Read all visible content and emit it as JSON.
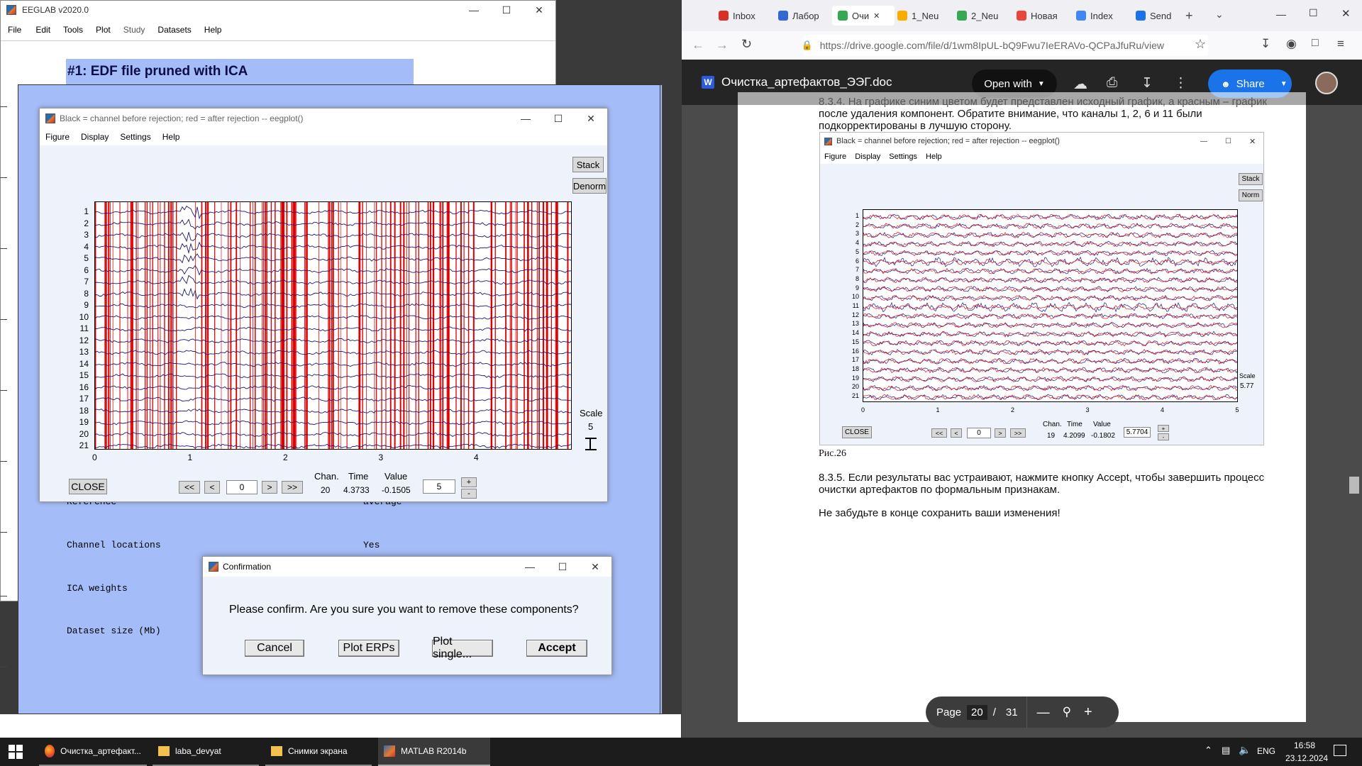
{
  "eeglab": {
    "title": "EEGLAB v2020.0",
    "menu": [
      "File",
      "Edit",
      "Tools",
      "Plot",
      "Study",
      "Datasets",
      "Help"
    ],
    "dataset_title": "#1: EDF file pruned with ICA",
    "rows": [
      {
        "label": "Reference",
        "value": "average"
      },
      {
        "label": "Channel locations",
        "value": "Yes"
      },
      {
        "label": "ICA weights",
        "value": ""
      },
      {
        "label": "Dataset size (Mb)",
        "value": ""
      }
    ]
  },
  "eegplot": {
    "title": "Black = channel before rejection; red = after rejection -- eegplot()",
    "menu": [
      "Figure",
      "Display",
      "Settings",
      "Help"
    ],
    "stack_label": "Stack",
    "norm_label": "Denorm",
    "channels": [
      "1",
      "2",
      "3",
      "4",
      "5",
      "6",
      "7",
      "8",
      "9",
      "10",
      "11",
      "12",
      "13",
      "14",
      "15",
      "16",
      "17",
      "18",
      "19",
      "20",
      "21"
    ],
    "x_ticks": [
      "0",
      "1",
      "2",
      "3",
      "4"
    ],
    "scale_label": "Scale",
    "scale_value": "5",
    "close_label": "CLOSE",
    "nav": [
      "<<",
      "<",
      "0",
      ">",
      ">>"
    ],
    "readout_headers": [
      "Chan.",
      "Time",
      "Value"
    ],
    "readout_values": [
      "20",
      "4.3733",
      "-0.1505"
    ],
    "scale_input": "5",
    "plus": "+",
    "minus": "-"
  },
  "confirm": {
    "title": "Confirmation",
    "message": "Please confirm. Are you sure you want to remove these components?",
    "buttons": [
      "Cancel",
      "Plot ERPs",
      "Plot single...",
      "Accept"
    ]
  },
  "browser": {
    "tabs": [
      "Inbox",
      "Лабор",
      "Очи",
      "1_Neu",
      "2_Neu",
      "Новая",
      "Index",
      "Send"
    ],
    "url": "https://drive.google.com/file/d/1wm8IpUL-bQ9Fwu7IeERAVo-QCPaJfuRu/view",
    "doc_title": "Очистка_артефактов_ЭЭГ.doc",
    "open_with": "Open with",
    "share": "Share",
    "pdf_text_1": "8.3.4. На графике синим цветом будет представлен исходный график, а красным – график",
    "pdf_text_2": "после удаления компонент. Обратите внимание, что каналы 1, 2, 6 и 11 были",
    "pdf_text_3": "подкорректированы в лучшую сторону.",
    "figure_caption": "Рис.26",
    "pdf_text_4": "8.3.5. Если результаты вас устраивают, нажмите кнопку Accept, чтобы завершить процесс",
    "pdf_text_5": "очистки артефактов по формальным признакам.",
    "pdf_text_6": "Не забудьте в конце сохранить ваши изменения!",
    "page_label": "Page",
    "page_current": "20",
    "page_sep": "/",
    "page_total": "31",
    "inner_plot": {
      "title": "Black = channel before rejection; red = after rejection -- eegplot()",
      "menu": [
        "Figure",
        "Display",
        "Settings",
        "Help"
      ],
      "stack": "Stack",
      "norm": "Norm",
      "scale_label": "Scale",
      "scale_value": "5.77",
      "close": "CLOSE",
      "x_ticks": [
        "0",
        "1",
        "2",
        "3",
        "4",
        "5"
      ],
      "readout_headers": [
        "Chan.",
        "Time",
        "Value"
      ],
      "readout_values": [
        "19",
        "4.2099",
        "-0.1802"
      ],
      "scale_input": "5.7704",
      "nav_value": "0"
    }
  },
  "taskbar": {
    "items": [
      "Очистка_артефакт...",
      "laba_devyat",
      "Снимки экрана",
      "MATLAB R2014b"
    ],
    "lang": "ENG",
    "time": "16:58",
    "date": "23.12.2024"
  }
}
